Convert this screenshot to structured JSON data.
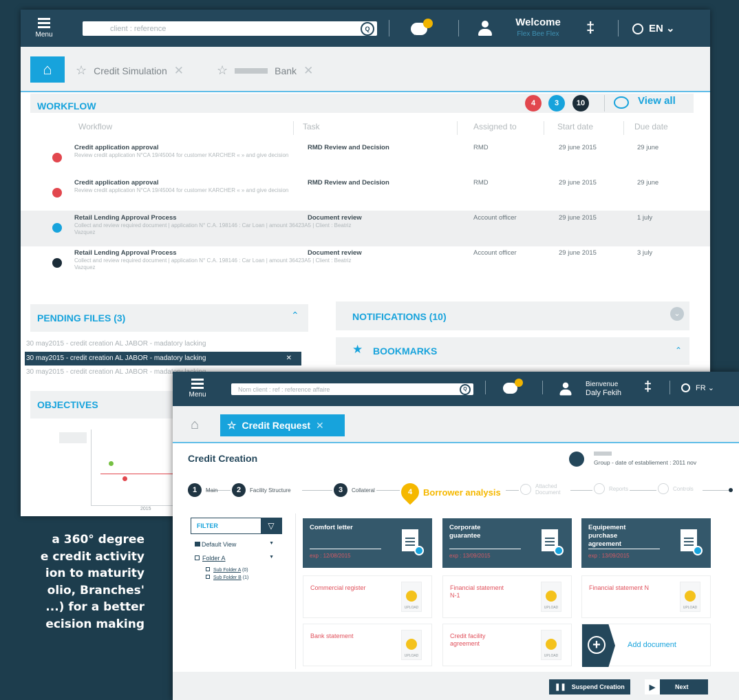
{
  "promo": {
    "line1": "a 360° degree",
    "line2": "e credit activity",
    "line3": "ion to maturity",
    "line4": "olio, Branches'",
    "line5": "...) for a better",
    "line6": "ecision making"
  },
  "win1": {
    "menu_label": "Menu",
    "search_placeholder": "client : reference",
    "welcome_title": "Welcome",
    "welcome_name": "Flex Bee Flex",
    "lang": "EN",
    "tabs": [
      {
        "label": "Credit Simulation"
      },
      {
        "label": "Bank"
      }
    ],
    "workflow": {
      "title": "WORKFLOW",
      "badges": [
        "4",
        "3",
        "10"
      ],
      "view_all": "View all",
      "columns": [
        "Workflow",
        "Task",
        "Assigned to",
        "Start date",
        "Due date"
      ],
      "rows": [
        {
          "title": "Credit application approval",
          "sub": "Review credit application N°CA 19/45004 for customer KARCHER « » and give decision",
          "task": "RMD  Review  and  Decision",
          "assigned": "RMD",
          "start": "29 june 2015",
          "due": "29 june",
          "color": "#e2474e"
        },
        {
          "title": "Credit application approval",
          "sub": "Review credit application N°CA 19/45004 for customer KARCHER « » and give decision",
          "task": "RMD  Review  and  Decision",
          "assigned": "RMD",
          "start": "29 june 2015",
          "due": "29 june",
          "color": "#e2474e"
        },
        {
          "title": "Retail Lending Approval Process",
          "sub": "Collect and review required document | application N° C.A. 198146 : Car Loan | amount 36423A5 | Client : Beatriz Vazquez",
          "task": "Document    review",
          "assigned": "Account officer",
          "start": "29 june 2015",
          "due": "1 july",
          "color": "#17a3dc"
        },
        {
          "title": "Retail Lending Approval Process",
          "sub": "Collect and review required document | application N° C.A. 198146 : Car Loan | amount 36423A5 | Client : Beatriz Vazquez",
          "task": "Document    review",
          "assigned": "Account officer",
          "start": "29 june 2015",
          "due": "3 july",
          "color": "#1b2c38"
        }
      ]
    },
    "pending": {
      "title": "PENDING FILES  (3)",
      "files": [
        "30 may2015 - credit creation AL JABOR - madatory lacking",
        "30 may2015 - credit creation AL JABOR - madatory lacking",
        "30 may2015 - credit creation AL JABOR - madatory lacking"
      ]
    },
    "notifications_title": "NOTIFICATIONS (10)",
    "bookmarks_title": "BOOKMARKS",
    "objectives_title": "OBJECTIVES",
    "objectives_axis": "2015"
  },
  "win2": {
    "menu_label": "Menu",
    "search_placeholder": "Nom client : ref : reference affaire",
    "welcome_title": "Bienvenue",
    "welcome_name": "Daly Fekih",
    "lang": "FR",
    "tab_label": "Credit Request",
    "page_title": "Credit Creation",
    "group_info": "Group - date of establiement : 2011 nov",
    "steps": [
      {
        "n": "1",
        "label": "Main"
      },
      {
        "n": "2",
        "label": "Facility Structure"
      },
      {
        "n": "3",
        "label": "Collateral"
      },
      {
        "n": "4",
        "label": "Borrower analysis"
      },
      {
        "n": "",
        "label": "Attached Document"
      },
      {
        "n": "",
        "label": "Reports"
      },
      {
        "n": "",
        "label": "Controls"
      }
    ],
    "filter": {
      "title": "FILTER",
      "default_view": "Default View",
      "folder": "Folder A",
      "sub1": "Sub Folder A",
      "sub1_count": "(0)",
      "sub2": "Sub Folder B",
      "sub2_count": "(1)"
    },
    "cards": [
      {
        "title": "Comfort letter",
        "exp": "exp : 12/08/2015"
      },
      {
        "title": "Corporate guarantee",
        "exp": "exp : 13/09/2015"
      },
      {
        "title": "Equipement purchase agreement",
        "exp": "exp : 13/09/2015"
      }
    ],
    "uploads": [
      {
        "title": "Commercial register"
      },
      {
        "title": "Financial statement N-1"
      },
      {
        "title": "Financial statement N"
      },
      {
        "title": "Bank statement"
      },
      {
        "title": "Credit facility agreement"
      }
    ],
    "upload_label": "UPLOAD",
    "add_document": "Add document",
    "suspend_label": "Suspend Creation",
    "next_label": "Next"
  }
}
